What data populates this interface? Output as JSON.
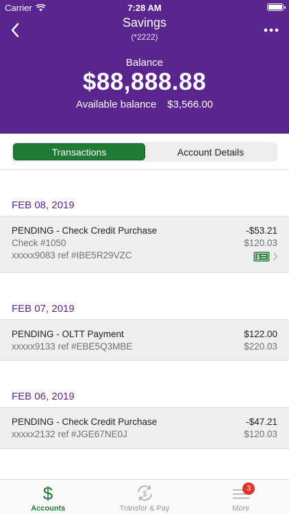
{
  "status_bar": {
    "carrier": "Carrier",
    "time": "7:28 AM"
  },
  "header": {
    "title": "Savings",
    "subtitle": "(*2222)",
    "balance_label": "Balance",
    "balance": "$88,888.88",
    "available_label": "Available balance",
    "available_value": "$3,566.00"
  },
  "tabs": [
    {
      "label": "Transactions",
      "active": true
    },
    {
      "label": "Account Details",
      "active": false
    }
  ],
  "groups": [
    {
      "date": "FEB 08, 2019",
      "transactions": [
        {
          "description": "PENDING - Check Credit Purchase",
          "detail": "Check #1050",
          "reference": "xxxxx9083 ref #IBE5R29VZC",
          "amount": "-$53.21",
          "running_balance": "$120.03",
          "has_check_image": true
        }
      ]
    },
    {
      "date": "FEB 07, 2019",
      "transactions": [
        {
          "description": "PENDING - OLTT Payment",
          "reference": "xxxxx9133 ref #EBE5Q3MBE",
          "amount": "$122.00",
          "running_balance": "$220.03"
        }
      ]
    },
    {
      "date": "FEB 06, 2019",
      "transactions": [
        {
          "description": "PENDING - Check Credit Purchase",
          "reference": "xxxxx2132 ref #JGE67NE0J",
          "amount": "-$47.21",
          "running_balance": "$120.03"
        }
      ]
    }
  ],
  "tabbar": {
    "items": [
      {
        "label": "Accounts",
        "icon": "dollar-icon",
        "active": true
      },
      {
        "label": "Transfer & Pay",
        "icon": "transfer-icon",
        "active": false
      },
      {
        "label": "More",
        "icon": "menu-icon",
        "active": false,
        "badge": "3"
      }
    ]
  },
  "colors": {
    "brand": "#5b2590",
    "accent": "#1f7a35",
    "badge": "#e0342b"
  }
}
